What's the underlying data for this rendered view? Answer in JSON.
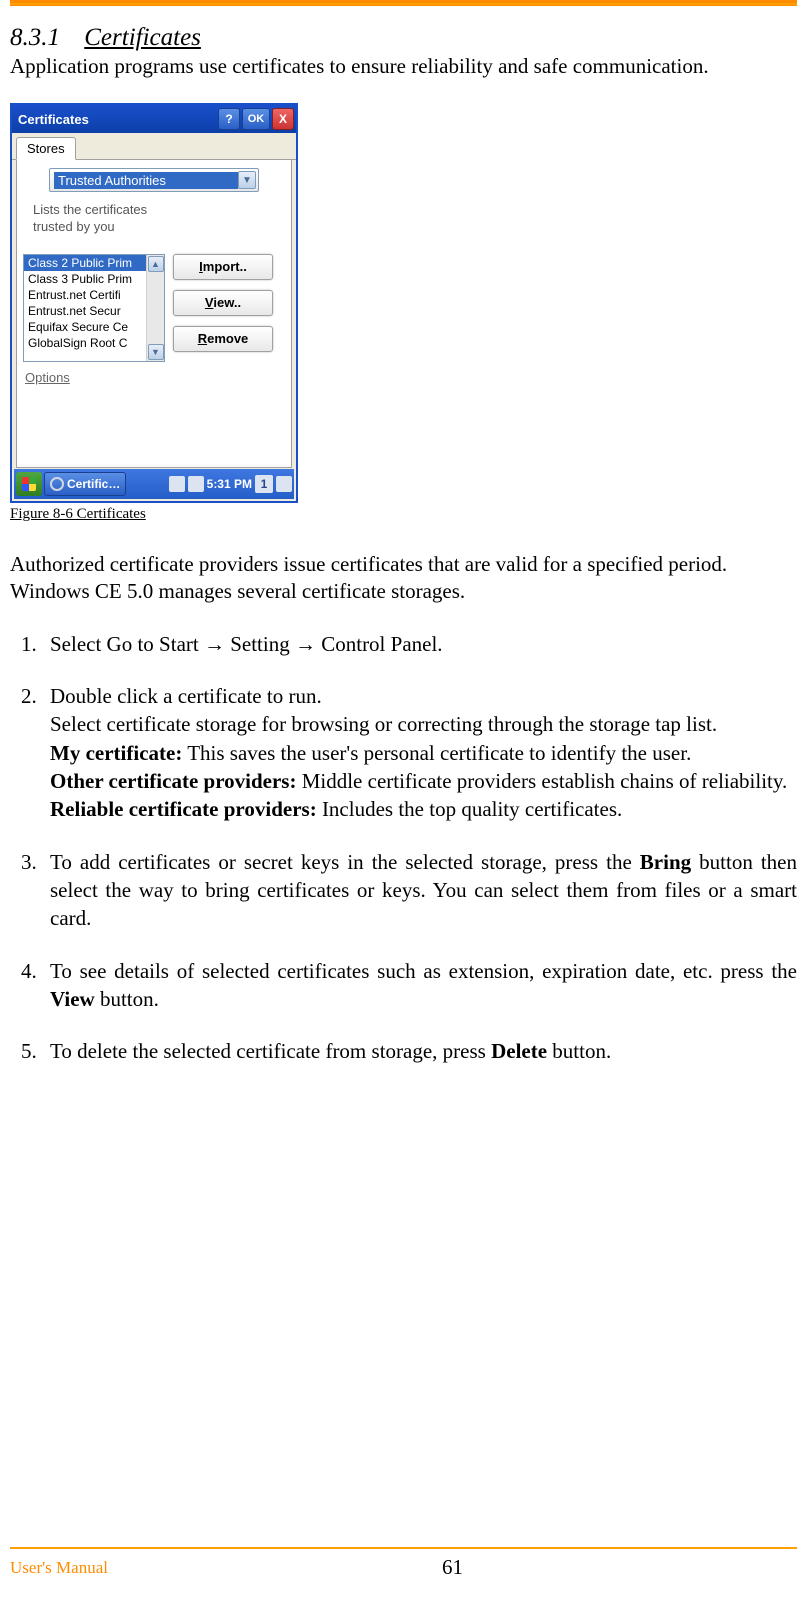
{
  "header": {
    "section_number": "8.3.1",
    "section_title": "Certificates"
  },
  "intro": "Application programs use certificates to ensure reliability and safe communication.",
  "screenshot": {
    "window_title": "Certificates",
    "titlebar": {
      "help": "?",
      "ok": "OK",
      "close": "X"
    },
    "tab": "Stores",
    "dropdown": {
      "selected": "Trusted Authorities"
    },
    "caption_l1": "Lists the certificates",
    "caption_l2": "trusted by you",
    "list": [
      "Class 2 Public Prim",
      "Class 3 Public Prim",
      "Entrust.net Certifi",
      "Entrust.net Secur",
      "Equifax Secure Ce",
      "GlobalSign Root C"
    ],
    "buttons": {
      "import": "Import..",
      "view": "View..",
      "remove": "Remove"
    },
    "import_accel": "I",
    "view_accel": "V",
    "remove_accel": "R",
    "options": "Options",
    "task_item": "Certific…",
    "clock": "5:31 PM",
    "tray_digit": "1"
  },
  "fig_caption": "Figure 8-6 Certificates",
  "body": {
    "p1": "Authorized certificate providers issue certificates that are valid for a specified period. Windows CE 5.0 manages several certificate storages.",
    "step1": "Select Go to Start  → Setting  → Control Panel.",
    "step2": {
      "l1": "Double click a certificate to run.",
      "l2": "Select certificate storage for browsing or correcting through the storage tap list.",
      "my_label": "My certificate:",
      "my_text": " This saves the user's personal certificate to identify the user.",
      "other_label": "Other certificate providers:",
      "other_text": " Middle certificate providers establish chains of reliability.",
      "reliable_label": "Reliable certificate providers:",
      "reliable_text": " Includes the top quality certificates."
    },
    "step3": {
      "pre": "To add certificates or secret keys in the selected storage, press the ",
      "bold": "Bring",
      "post": " button then select the way to bring certificates or keys. You can select them from files or a smart card."
    },
    "step4": {
      "pre": "To see details of selected certificates such as extension, expiration date, etc. press the ",
      "bold": "View",
      "post": " button."
    },
    "step5": {
      "pre": "To delete the selected certificate from storage, press ",
      "bold": "Delete",
      "post": " button."
    }
  },
  "footer": {
    "left": "User's Manual",
    "page": "61"
  }
}
